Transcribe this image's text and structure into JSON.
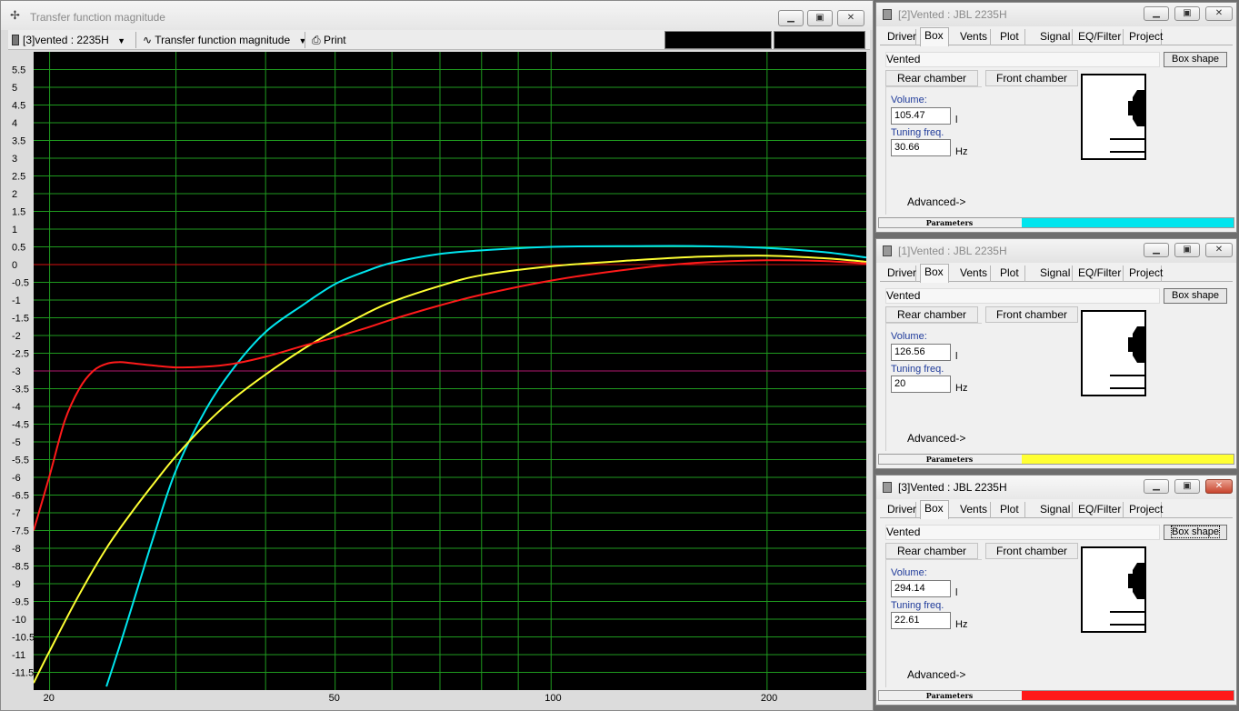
{
  "main": {
    "title": "Transfer function magnitude",
    "project_selector": "[3]vented : 2235H",
    "view_selector": "Transfer function magnitude",
    "print_label": "Print"
  },
  "chart_data": {
    "type": "line",
    "title": "",
    "xlabel": "",
    "ylabel": "",
    "x_scale": "log",
    "xlim": [
      19,
      275
    ],
    "ylim": [
      -12,
      6
    ],
    "x_tick_labels": [
      "20",
      "50",
      "100",
      "200"
    ],
    "y_tick_labels": [
      "5.5",
      "5",
      "4.5",
      "4",
      "3.5",
      "3",
      "2.5",
      "2",
      "1.5",
      "1",
      "0.5",
      "0",
      "-0.5",
      "-1",
      "-1.5",
      "-2",
      "-2.5",
      "-3",
      "-3.5",
      "-4",
      "-4.5",
      "-5",
      "-5.5",
      "-6",
      "-6.5",
      "-7",
      "-7.5",
      "-8",
      "-8.5",
      "-9",
      "-9.5",
      "-10",
      "-10.5",
      "-11",
      "-11.5"
    ],
    "reference_lines": [
      {
        "y": 0,
        "color": "#d81010"
      },
      {
        "y": -3,
        "color": "#b0196e"
      }
    ],
    "grid": true,
    "background": "#000000",
    "grid_color": "#1f9a1f",
    "series": [
      {
        "color": "#00e5ee",
        "x": [
          24,
          25,
          26,
          28,
          30,
          33,
          36,
          40,
          45,
          50,
          55,
          60,
          70,
          80,
          100,
          130,
          160,
          200,
          240,
          275
        ],
        "y": [
          -11.9,
          -10.8,
          -9.7,
          -7.6,
          -5.8,
          -4.1,
          -2.95,
          -1.9,
          -1.15,
          -0.55,
          -0.2,
          0.05,
          0.3,
          0.4,
          0.5,
          0.52,
          0.52,
          0.47,
          0.35,
          0.2
        ]
      },
      {
        "color": "#ffff33",
        "x": [
          19,
          20,
          22,
          24,
          26,
          28,
          30,
          33,
          36,
          40,
          45,
          50,
          55,
          60,
          70,
          80,
          100,
          130,
          160,
          200,
          240,
          275
        ],
        "y": [
          -11.8,
          -10.9,
          -9.3,
          -8.0,
          -7.0,
          -6.15,
          -5.4,
          -4.5,
          -3.8,
          -3.1,
          -2.4,
          -1.85,
          -1.4,
          -1.05,
          -0.6,
          -0.3,
          -0.05,
          0.12,
          0.22,
          0.25,
          0.18,
          0.08
        ]
      },
      {
        "color": "#ff1a1a",
        "x": [
          19,
          20,
          21,
          22,
          23,
          24,
          25,
          26,
          28,
          30,
          33,
          36,
          40,
          45,
          50,
          55,
          60,
          70,
          80,
          100,
          130,
          160,
          200,
          240,
          275
        ],
        "y": [
          -7.5,
          -5.95,
          -4.4,
          -3.5,
          -3.0,
          -2.8,
          -2.75,
          -2.78,
          -2.85,
          -2.9,
          -2.88,
          -2.8,
          -2.6,
          -2.3,
          -2.05,
          -1.8,
          -1.55,
          -1.15,
          -0.85,
          -0.45,
          -0.12,
          0.05,
          0.12,
          0.1,
          0.03
        ]
      }
    ]
  },
  "panels": [
    {
      "title": "[2]Vented : JBL 2235H",
      "tabs": [
        "Driver",
        "Box",
        "Vents",
        "Plot",
        "Signal",
        "EQ/Filter",
        "Project"
      ],
      "box_type": "Vented",
      "box_shape_label": "Box shape",
      "rear_chamber_label": "Rear chamber",
      "front_chamber_label": "Front chamber",
      "volume_label": "Volume:",
      "volume_value": "105.47",
      "volume_unit": "l",
      "tuning_label": "Tuning freq.",
      "tuning_value": "30.66",
      "tuning_unit": "Hz",
      "advanced_label": "Advanced->",
      "status_label": "Parameters",
      "status_color": "#00e5ee"
    },
    {
      "title": "[1]Vented : JBL 2235H",
      "tabs": [
        "Driver",
        "Box",
        "Vents",
        "Plot",
        "Signal",
        "EQ/Filter",
        "Project"
      ],
      "box_type": "Vented",
      "box_shape_label": "Box shape",
      "rear_chamber_label": "Rear chamber",
      "front_chamber_label": "Front chamber",
      "volume_label": "Volume:",
      "volume_value": "126.56",
      "volume_unit": "l",
      "tuning_label": "Tuning freq.",
      "tuning_value": "20",
      "tuning_unit": "Hz",
      "advanced_label": "Advanced->",
      "status_label": "Parameters",
      "status_color": "#ffff33"
    },
    {
      "title": "[3]Vented : JBL 2235H",
      "tabs": [
        "Driver",
        "Box",
        "Vents",
        "Plot",
        "Signal",
        "EQ/Filter",
        "Project"
      ],
      "box_type": "Vented",
      "box_shape_label": "Box shape",
      "rear_chamber_label": "Rear chamber",
      "front_chamber_label": "Front chamber",
      "volume_label": "Volume:",
      "volume_value": "294.14",
      "volume_unit": "l",
      "tuning_label": "Tuning freq.",
      "tuning_value": "22.61",
      "tuning_unit": "Hz",
      "advanced_label": "Advanced->",
      "status_label": "Parameters",
      "status_color": "#ff1a1a"
    }
  ]
}
